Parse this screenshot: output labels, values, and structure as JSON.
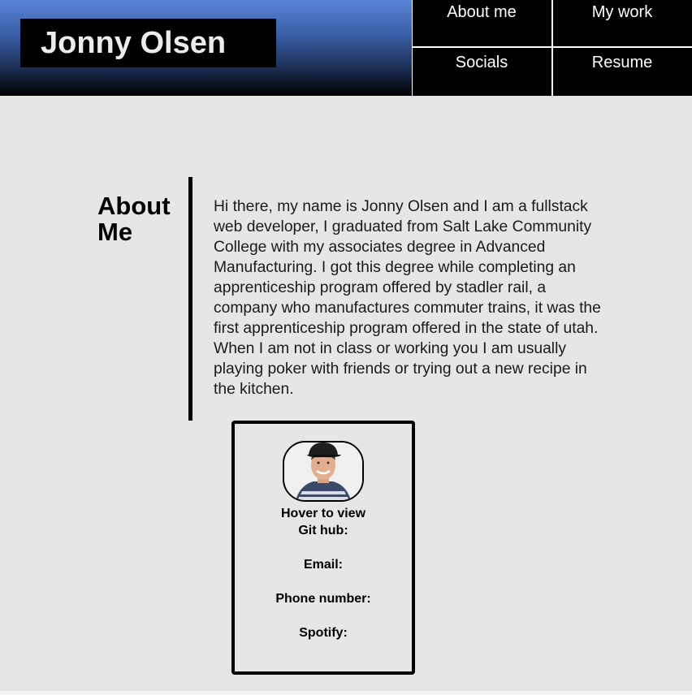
{
  "header": {
    "name": "Jonny Olsen",
    "gradient_top": "#5a84d6",
    "gradient_bottom": "#000000"
  },
  "nav": {
    "items": [
      {
        "label": "About me"
      },
      {
        "label": "My work"
      },
      {
        "label": "Socials"
      },
      {
        "label": "Resume"
      }
    ]
  },
  "about": {
    "title": "About Me",
    "text": "Hi there, my name is Jonny Olsen and I am a fullstack web developer, I graduated from Salt Lake Community College with my associates degree in Advanced Manufacturing. I got this degree while completing an apprenticeship program offered by stadler rail, a company who manufactures commuter trains, it was the first apprenticeship program offered in the state of utah. When I am not in class or working you I am usually playing poker with friends or trying out a new recipe in the kitchen."
  },
  "card": {
    "avatar_icon": "profile-photo",
    "hover_hint": "Hover to view",
    "github_label": "Git hub:",
    "email_label": "Email:",
    "phone_label": "Phone number:",
    "spotify_label": "Spotify:"
  },
  "colors": {
    "page_background": "#e6e6e6",
    "nav_background": "#000000",
    "nav_text": "#ffffff"
  }
}
